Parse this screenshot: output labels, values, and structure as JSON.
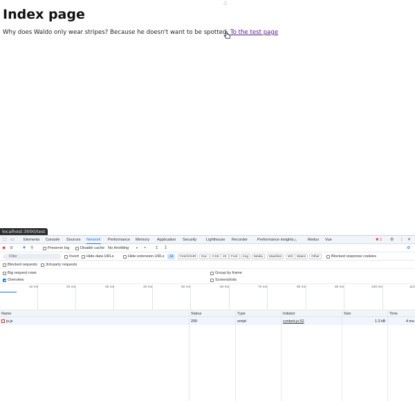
{
  "page": {
    "heading": "Index page",
    "text": "Why does Waldo only wear stripes? Because he doesn't want to be spotted.",
    "link_text": "To the test page",
    "status_url": "localhost:3000/test"
  },
  "devtools": {
    "tabs": [
      "Elements",
      "Console",
      "Sources",
      "Network",
      "Performance",
      "Memory",
      "Application",
      "Security",
      "Lighthouse",
      "Recorder",
      "Performance insights",
      "Redux",
      "Vue"
    ],
    "active_tab": "Network",
    "error_count": "1",
    "toolbar": {
      "preserve_log": "Preserve log",
      "disable_cache": "Disable cache",
      "throttling": "No throttling"
    },
    "filter": {
      "placeholder": "Filter",
      "invert": "Invert",
      "hide_data_urls": "Hide data URLs",
      "hide_extension_urls": "Hide extension URLs",
      "types": [
        "All",
        "Fetch/XHR",
        "Doc",
        "CSS",
        "JS",
        "Font",
        "Img",
        "Media",
        "Manifest",
        "WS",
        "Wasm",
        "Other"
      ],
      "blocked_response_cookies": "Blocked response cookies"
    },
    "options": {
      "blocked_requests": "Blocked requests",
      "third_party_requests": "3rd-party requests",
      "big_request_rows": "Big request rows",
      "group_by_frame": "Group by frame",
      "overview": "Overview",
      "screenshots": "Screenshots"
    },
    "timeline_ticks": [
      "10 ms",
      "20 ms",
      "30 ms",
      "40 ms",
      "50 ms",
      "60 ms",
      "70 ms",
      "80 ms",
      "90 ms",
      "100 ms",
      "110"
    ],
    "columns": [
      "Name",
      "Status",
      "Type",
      "Initiator",
      "Size",
      "Time"
    ],
    "rows": [
      {
        "name": "js.js",
        "status": "200",
        "type": "script",
        "initiator": "content.js:52",
        "size": "1.3 kB",
        "time": "4 ms"
      }
    ]
  }
}
